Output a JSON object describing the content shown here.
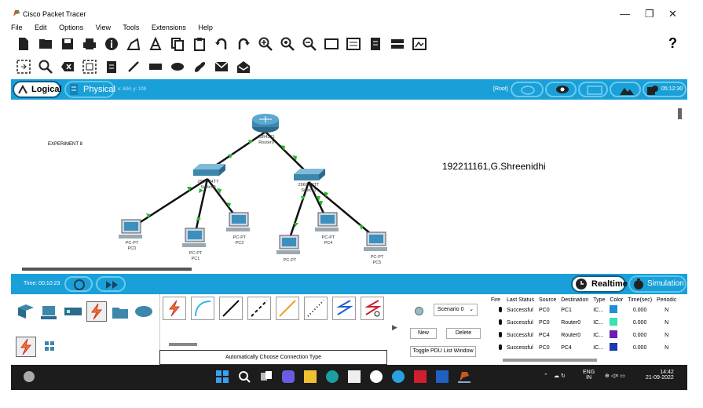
{
  "window": {
    "title": "Cisco Packet Tracer"
  },
  "menu": [
    "File",
    "Edit",
    "Options",
    "View",
    "Tools",
    "Extensions",
    "Help"
  ],
  "modebar": {
    "logical": "Logical",
    "physical": "Physical",
    "coords": "x: 634, y: 109",
    "root": "[Root]",
    "clock": "05:12:30"
  },
  "workspace": {
    "experiment_label": "EXPERIMENT 8",
    "student_label": "192211161,G.Shreenidhi",
    "router": {
      "model": "ISR4331",
      "name": "Router0"
    },
    "switches": [
      {
        "model": "2960-24TT",
        "name": "Switch0"
      },
      {
        "model": "2960-24TT",
        "name": "Switch1"
      }
    ],
    "pcs": [
      {
        "model": "PC-PT",
        "name": "PC0"
      },
      {
        "model": "PC-PT",
        "name": "PC1"
      },
      {
        "model": "PC-PT",
        "name": "PC2"
      },
      {
        "model": "PC-PT",
        "name": "PC3"
      },
      {
        "model": "PC-PT",
        "name": "PC4"
      },
      {
        "model": "PC-PT",
        "name": "PC5"
      }
    ]
  },
  "timebar": {
    "time": "Time: 00:10:23",
    "realtime": "Realtime",
    "simulation": "Simulation"
  },
  "connections": {
    "caption": "Automatically Choose Connection Type"
  },
  "scenario": {
    "selected": "Scenario 0",
    "new": "New",
    "delete": "Delete",
    "toggle": "Toggle PDU List Window"
  },
  "pdu_table": {
    "headers": [
      "Fire",
      "Last Status",
      "Source",
      "Destination",
      "Type",
      "Color",
      "Time(sec)",
      "Periodic"
    ],
    "rows": [
      {
        "status": "Successful",
        "source": "PC0",
        "destination": "PC1",
        "type": "IC...",
        "color": "#1e90d8",
        "time": "0.000",
        "periodic": "N"
      },
      {
        "status": "Successful",
        "source": "PC0",
        "destination": "Router0",
        "type": "IC...",
        "color": "#3de0b0",
        "time": "0.000",
        "periodic": "N"
      },
      {
        "status": "Successful",
        "source": "PC4",
        "destination": "Router0",
        "type": "IC...",
        "color": "#6a1fb0",
        "time": "0.000",
        "periodic": "N"
      },
      {
        "status": "Successful",
        "source": "PC0",
        "destination": "PC4",
        "type": "IC...",
        "color": "#1a3bb0",
        "time": "0.000",
        "periodic": "N"
      }
    ]
  },
  "taskbar": {
    "lang": "ENG",
    "region": "IN",
    "time": "14:42",
    "date": "21-09-2022"
  },
  "help": "?"
}
